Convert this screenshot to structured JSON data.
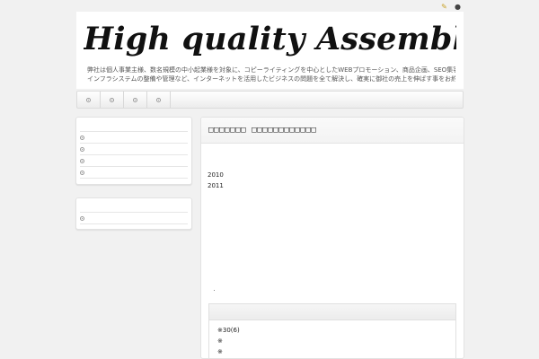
{
  "header": {
    "logo_text": "High quality Assemblage",
    "tagline_line1": "弊社は個人事業主様、数名規模の中小起業様を対象に、コピーライティングを中心としたWEBプロモーション、商品企画、SEO集客、SNS集客、",
    "tagline_line2": "インフラシステムの整備や管理など、インターネットを活用したビジネスの問題を全て解決し、確実に御社の売上を伸ばす事をお約束します。"
  },
  "top_icons": [
    "edit-icon",
    "user-icon"
  ],
  "nav": {
    "items": [
      "",
      "",
      "",
      ""
    ]
  },
  "sidebar": {
    "box1_items": [
      "",
      "",
      "",
      ""
    ],
    "box2_items": [
      ""
    ]
  },
  "main": {
    "title": "□□□□□□□ □□□□□□□□□□□□",
    "archive_years": [
      "2010",
      "2011"
    ],
    "list": [
      "※30(6)",
      "※",
      "※"
    ]
  },
  "colors": {
    "background": "#f1f1f1",
    "panel": "#ffffff",
    "border": "#e2e2e2"
  }
}
